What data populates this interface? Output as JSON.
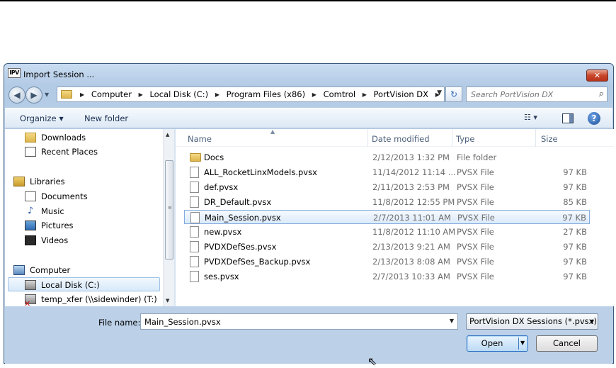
{
  "window": {
    "app_icon_text": "IPV",
    "title": "Import Session ...",
    "close_glyph": "✕"
  },
  "address": {
    "crumbs": [
      "Computer",
      "Local Disk (C:)",
      "Program Files (x86)",
      "Comtrol",
      "PortVision DX"
    ],
    "search_placeholder": "Search PortVision DX"
  },
  "toolbar": {
    "organize": "Organize",
    "new_folder": "New folder",
    "help_glyph": "?"
  },
  "nav": {
    "items": [
      {
        "label": "Downloads",
        "icon": "downloads-icon"
      },
      {
        "label": "Recent Places",
        "icon": "recent-places-icon"
      },
      {
        "label": "Libraries",
        "icon": "libraries-icon"
      },
      {
        "label": "Documents",
        "icon": "documents-icon"
      },
      {
        "label": "Music",
        "icon": "music-icon"
      },
      {
        "label": "Pictures",
        "icon": "pictures-icon"
      },
      {
        "label": "Videos",
        "icon": "videos-icon"
      },
      {
        "label": "Computer",
        "icon": "computer-icon"
      },
      {
        "label": "Local Disk (C:)",
        "icon": "disk-icon",
        "selected": true
      },
      {
        "label": "temp_xfer (\\\\sidewinder) (T:)",
        "icon": "network-drive-icon"
      }
    ]
  },
  "files": {
    "columns": {
      "name": "Name",
      "date": "Date modified",
      "type": "Type",
      "size": "Size"
    },
    "rows": [
      {
        "name": "Docs",
        "date": "2/12/2013 1:32 PM",
        "type": "File folder",
        "size": "",
        "kind": "folder"
      },
      {
        "name": "ALL_RocketLinxModels.pvsx",
        "date": "11/14/2012 11:14 ...",
        "type": "PVSX File",
        "size": "97 KB",
        "kind": "file"
      },
      {
        "name": "def.pvsx",
        "date": "2/11/2013 2:53 PM",
        "type": "PVSX File",
        "size": "97 KB",
        "kind": "file"
      },
      {
        "name": "DR_Default.pvsx",
        "date": "11/8/2012 12:55 PM",
        "type": "PVSX File",
        "size": "85 KB",
        "kind": "file"
      },
      {
        "name": "Main_Session.pvsx",
        "date": "2/7/2013 11:01 AM",
        "type": "PVSX File",
        "size": "97 KB",
        "kind": "file",
        "selected": true
      },
      {
        "name": "new.pvsx",
        "date": "11/8/2012 11:10 AM",
        "type": "PVSX File",
        "size": "27 KB",
        "kind": "file"
      },
      {
        "name": "PVDXDefSes.pvsx",
        "date": "2/13/2013 9:21 AM",
        "type": "PVSX File",
        "size": "97 KB",
        "kind": "file"
      },
      {
        "name": "PVDXDefSes_Backup.pvsx",
        "date": "2/13/2013 8:08 AM",
        "type": "PVSX File",
        "size": "97 KB",
        "kind": "file"
      },
      {
        "name": "ses.pvsx",
        "date": "2/7/2013 10:33 AM",
        "type": "PVSX File",
        "size": "97 KB",
        "kind": "file"
      }
    ]
  },
  "bottom": {
    "file_name_label": "File name:",
    "file_name_value": "Main_Session.pvsx",
    "filter_value": "PortVision DX Sessions (*.pvsx)",
    "open_label": "Open",
    "cancel_label": "Cancel"
  }
}
